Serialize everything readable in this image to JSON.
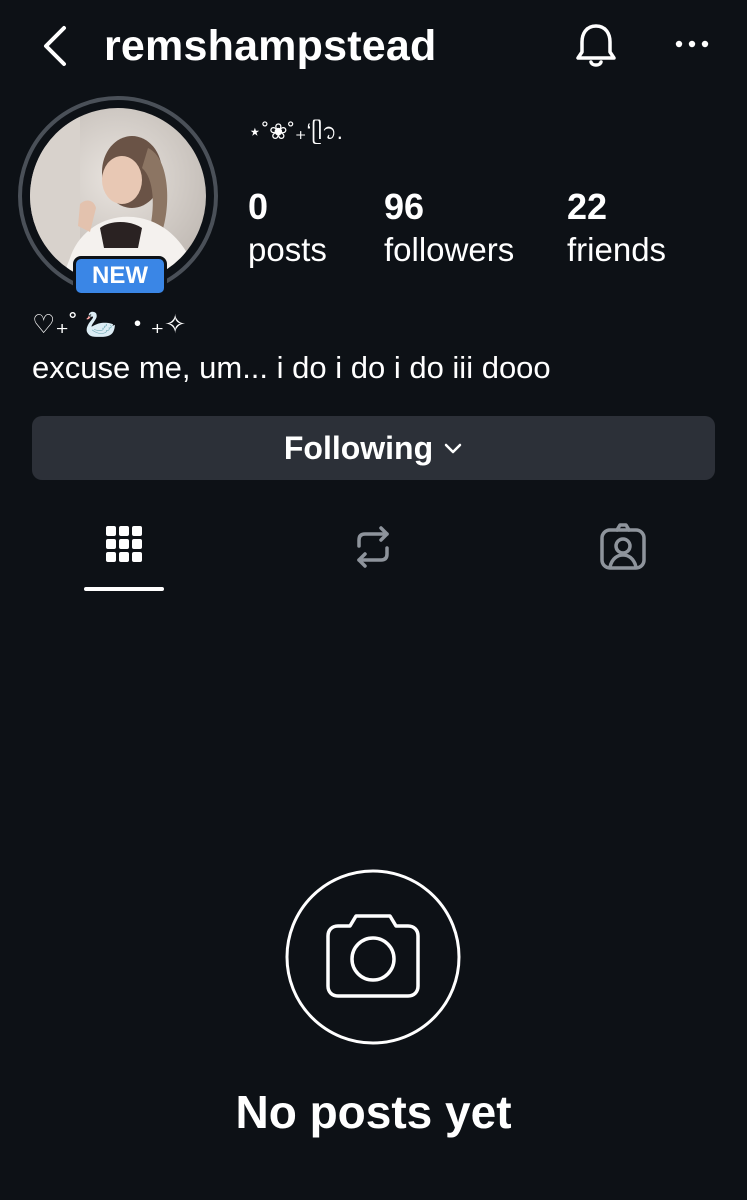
{
  "header": {
    "username": "remshampstead",
    "back_icon": "chevron-left-icon",
    "bell_icon": "bell-icon",
    "more_icon": "more-horizontal-icon"
  },
  "profile": {
    "badge": "NEW",
    "nickname": "⋆˚❀˚₊‘ᥫ᭡.",
    "stats": [
      {
        "value": "0",
        "label": "posts"
      },
      {
        "value": "96",
        "label": "followers"
      },
      {
        "value": "22",
        "label": "friends"
      }
    ],
    "bio_emoji": "♡₊˚ 🦢 ・₊✧",
    "bio_text": "excuse me, um... i do i do i do iii dooo"
  },
  "actions": {
    "follow_label": "Following"
  },
  "tabs": [
    {
      "icon": "grid-icon",
      "active": true
    },
    {
      "icon": "repost-icon",
      "active": false
    },
    {
      "icon": "tagged-icon",
      "active": false
    }
  ],
  "empty_state": {
    "icon": "camera-icon",
    "title": "No posts yet"
  },
  "colors": {
    "background": "#0d1116",
    "button": "#2c3038",
    "badge": "#3a86e6",
    "icon_muted": "#8e949c"
  }
}
